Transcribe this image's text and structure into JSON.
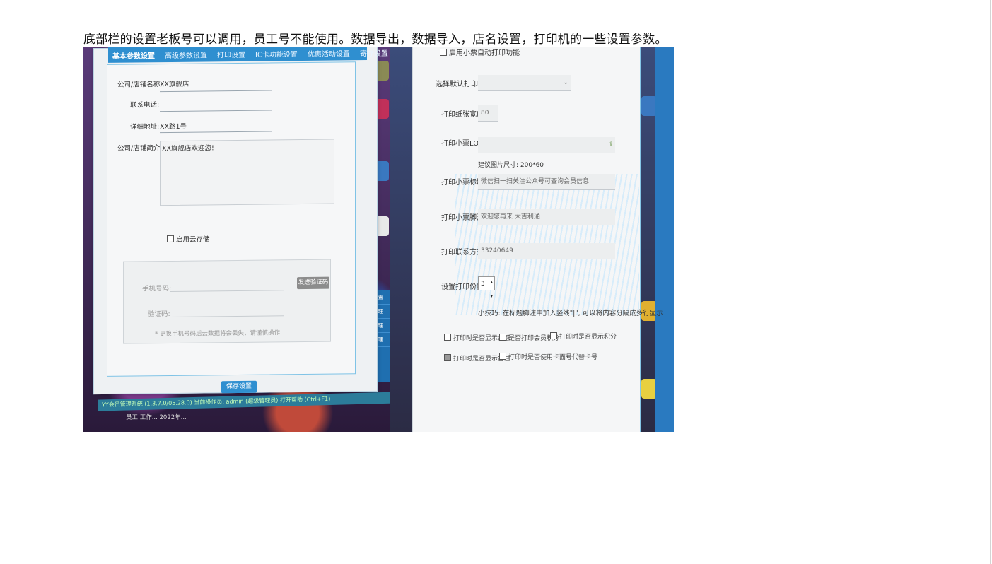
{
  "caption": "底部栏的设置老板号可以调用，员工号不能使用。数据导出，数据导入，店名设置，打印机的一些设置参数。",
  "left_screen": {
    "tabs": [
      "基本参数设置",
      "高级参数设置",
      "打印设置",
      "IC卡功能设置",
      "优惠活动设置",
      "寄存设置"
    ],
    "store_name_label": "公司/店铺名称:",
    "store_name_value": "XX旗舰店",
    "phone_label": "联系电话:",
    "phone_value": "",
    "address_label": "详细地址:",
    "address_value": "XX路1号",
    "intro_label": "公司/店铺简介:",
    "intro_value": "XX旗舰店欢迎您!",
    "cloud_storage_label": "启用云存储",
    "mobile_label": "手机号码:",
    "send_code_button": "发送验证码",
    "code_label": "验证码:",
    "warning": "* 更换手机号码后云数据将会丢失，请谨慎操作",
    "save_button": "保存设置",
    "status_bar": "YY会员管理系统 (1.3.7.0/05.28.0)  当前操作员: admin (超级管理员)  打开帮助 (Ctrl+F1)",
    "side_menu": [
      "会员设置",
      "储值管理",
      "会员管理",
      "产品管理"
    ],
    "taskbar": "员工 工作...  2022年..."
  },
  "right_screen": {
    "auto_print_label": "启用小票自动打印功能",
    "printer_label": "选择默认打印机:",
    "printer_value": "",
    "paper_width_label": "打印纸张宽度:",
    "paper_width_value": "80",
    "logo_label": "打印小票LOGO:",
    "logo_hint": "建议图片尺寸: 200*60",
    "title_label": "打印小票标题:",
    "title_value": "微信扫一扫关注公众号可查询会员信息",
    "footer_label": "打印小票脚注:",
    "footer_value": "欢迎您再来 大吉利通",
    "contact_label": "打印联系方式:",
    "contact_value": "33240649",
    "copies_label": "设置打印份数:",
    "copies_value": "3",
    "tip": "小技巧: 在标题脚注中加入竖线\"|\", 可以将内容分隔成多行显示",
    "options": [
      "打印时是否显示余额",
      "是否打印会员积分",
      "打印时是否显示积分",
      "打印时是否显示备注",
      "打印时是否使用卡面号代替卡号"
    ]
  }
}
